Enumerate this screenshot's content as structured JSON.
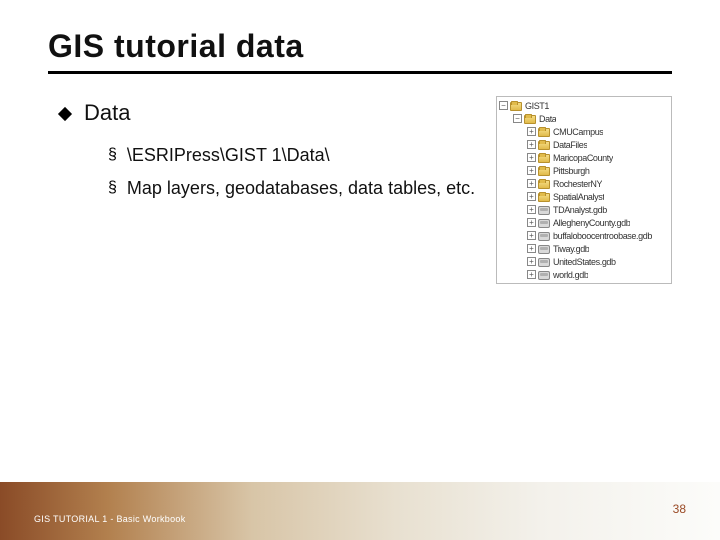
{
  "title": "GIS tutorial data",
  "bullets": {
    "l1": "Data",
    "sub": [
      "\\ESRIPress\\GIST 1\\Data\\",
      "Map layers, geodatabases, data tables, etc."
    ]
  },
  "tree": {
    "root": "GIST1",
    "dataFolder": "Data",
    "items": [
      {
        "type": "folder",
        "label": "CMUCampus"
      },
      {
        "type": "folder",
        "label": "DataFiles"
      },
      {
        "type": "folder",
        "label": "MaricopaCounty"
      },
      {
        "type": "folder",
        "label": "Pittsburgh"
      },
      {
        "type": "folder",
        "label": "RochesterNY"
      },
      {
        "type": "folder",
        "label": "SpatialAnalyst"
      },
      {
        "type": "gdb",
        "label": "TDAnalyst.gdb"
      },
      {
        "type": "gdb",
        "label": "AlleghenyCounty.gdb"
      },
      {
        "type": "gdb",
        "label": "buffaloboocentroobase.gdb"
      },
      {
        "type": "gdb",
        "label": "Tiway.gdb"
      },
      {
        "type": "gdb",
        "label": "UnitedStates.gdb"
      },
      {
        "type": "gdb",
        "label": "world.gdb"
      }
    ]
  },
  "footer": "GIS TUTORIAL 1 - Basic Workbook",
  "page": "38",
  "glyphs": {
    "plus": "+",
    "minus": "−",
    "section": "§"
  }
}
